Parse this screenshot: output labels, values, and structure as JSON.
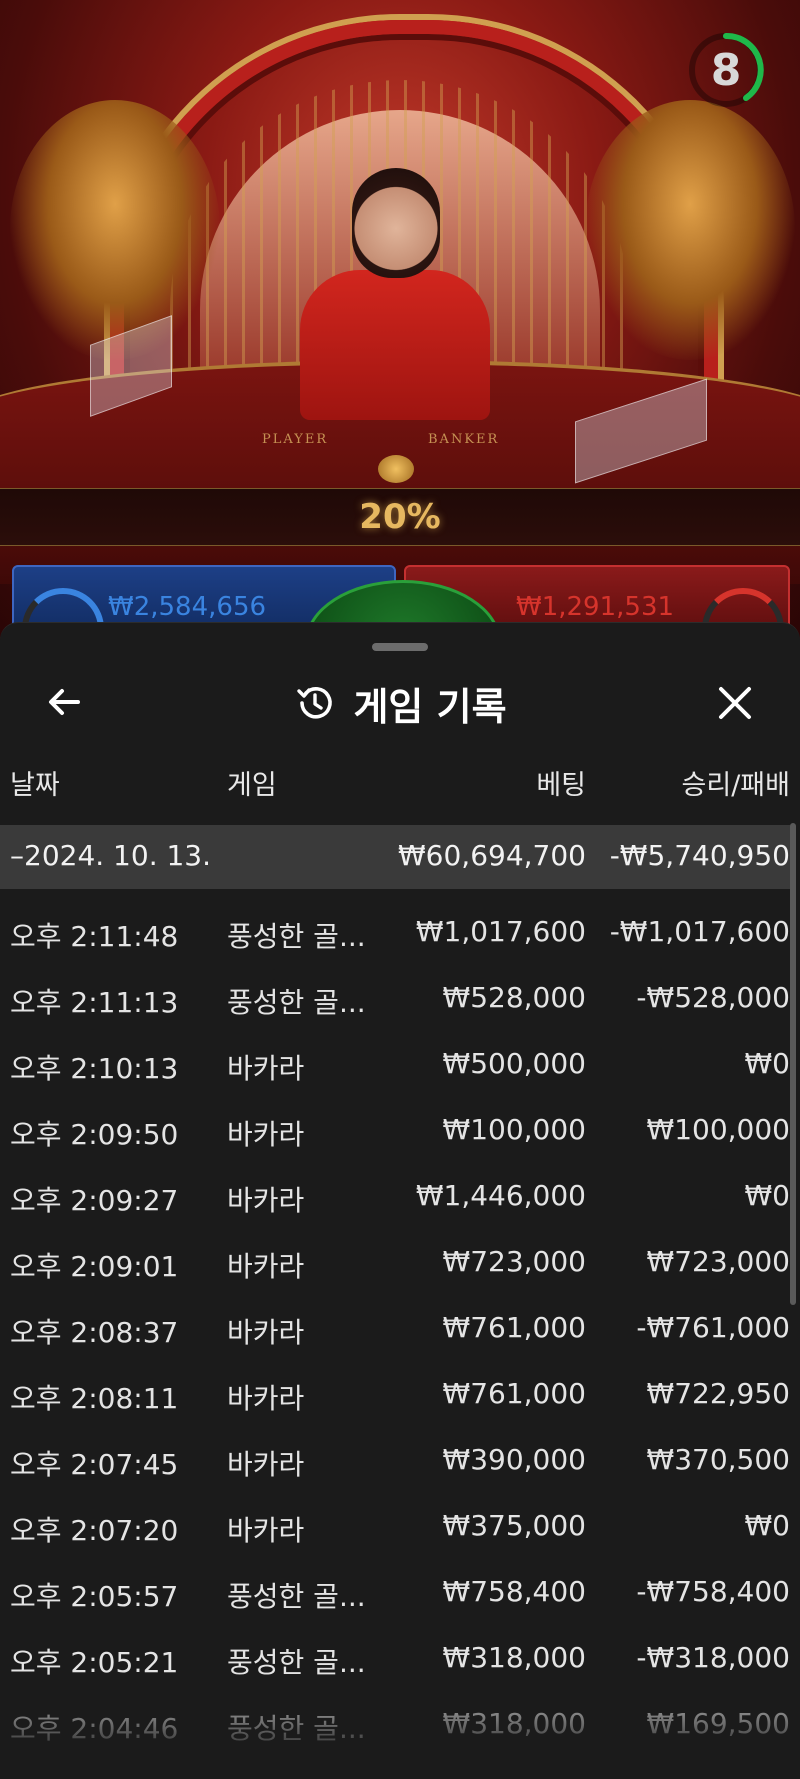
{
  "game_view": {
    "countdown": "8",
    "percent_banner": "20%",
    "table_labels": [
      "PLAYER",
      "BANKER"
    ],
    "player_total": "₩2,584,656",
    "banker_total": "₩1,291,531",
    "colors": {
      "player": "#3a84e0",
      "banker": "#d6342c",
      "tie": "#1f7a2a",
      "gold": "#e6b860"
    }
  },
  "sheet": {
    "title": "게임 기록",
    "icons": {
      "back": "arrow-left-icon",
      "title": "history-icon",
      "close": "close-icon"
    },
    "columns": {
      "date": "날짜",
      "game": "게임",
      "bet": "베팅",
      "win": "승리/패배"
    },
    "day_group": {
      "date": "–2024. 10. 13.",
      "bet": "₩60,694,700",
      "win": "-₩5,740,950"
    },
    "rows": [
      {
        "time": "오후 2:11:48",
        "game": "풍성한 골...",
        "bet": "₩1,017,600",
        "win": "-₩1,017,600"
      },
      {
        "time": "오후 2:11:13",
        "game": "풍성한 골...",
        "bet": "₩528,000",
        "win": "-₩528,000"
      },
      {
        "time": "오후 2:10:13",
        "game": "바카라",
        "bet": "₩500,000",
        "win": "₩0"
      },
      {
        "time": "오후 2:09:50",
        "game": "바카라",
        "bet": "₩100,000",
        "win": "₩100,000"
      },
      {
        "time": "오후 2:09:27",
        "game": "바카라",
        "bet": "₩1,446,000",
        "win": "₩0"
      },
      {
        "time": "오후 2:09:01",
        "game": "바카라",
        "bet": "₩723,000",
        "win": "₩723,000"
      },
      {
        "time": "오후 2:08:37",
        "game": "바카라",
        "bet": "₩761,000",
        "win": "-₩761,000"
      },
      {
        "time": "오후 2:08:11",
        "game": "바카라",
        "bet": "₩761,000",
        "win": "₩722,950"
      },
      {
        "time": "오후 2:07:45",
        "game": "바카라",
        "bet": "₩390,000",
        "win": "₩370,500"
      },
      {
        "time": "오후 2:07:20",
        "game": "바카라",
        "bet": "₩375,000",
        "win": "₩0"
      },
      {
        "time": "오후 2:05:57",
        "game": "풍성한 골...",
        "bet": "₩758,400",
        "win": "-₩758,400"
      },
      {
        "time": "오후 2:05:21",
        "game": "풍성한 골...",
        "bet": "₩318,000",
        "win": "-₩318,000"
      },
      {
        "time": "오후 2:04:46",
        "game": "풍성한 골...",
        "bet": "₩318,000",
        "win": "₩169,500"
      }
    ]
  }
}
